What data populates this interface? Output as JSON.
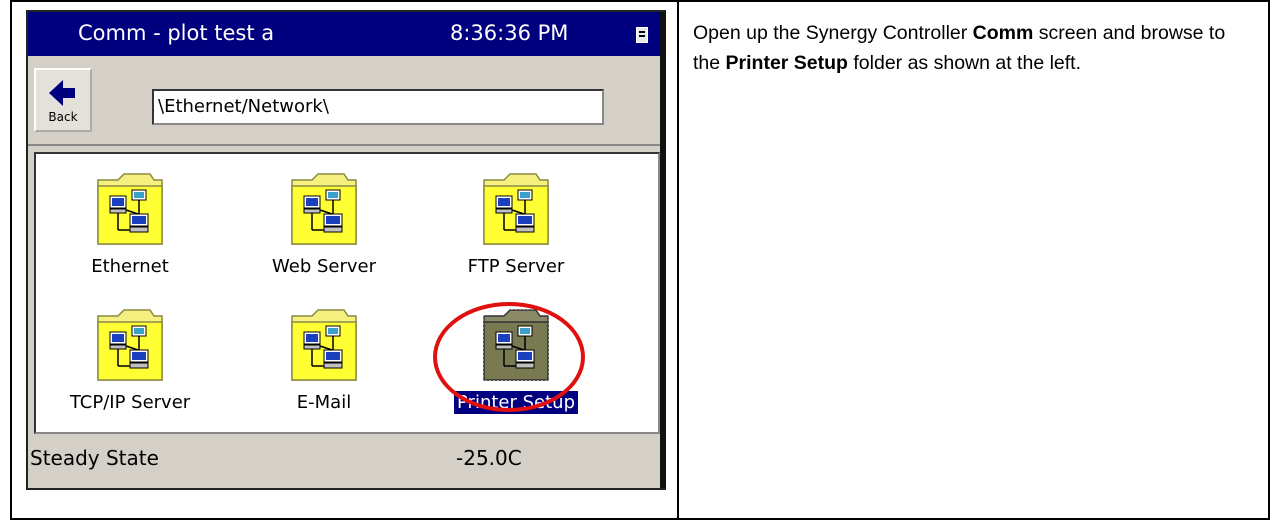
{
  "device": {
    "title": "Comm - plot test a",
    "clock": "8:36:36 PM",
    "back_label": "Back",
    "path": "\\Ethernet/Network\\",
    "folders": [
      {
        "label": "Ethernet",
        "icon": "network-folder-icon"
      },
      {
        "label": "Web Server",
        "icon": "network-folder-icon"
      },
      {
        "label": "FTP Server",
        "icon": "network-folder-icon"
      },
      {
        "label": "TCP/IP Server",
        "icon": "network-folder-icon"
      },
      {
        "label": "E-Mail",
        "icon": "network-folder-icon"
      },
      {
        "label": "Printer Setup",
        "icon": "network-folder-icon",
        "selected": true
      }
    ],
    "status": {
      "state": "Steady State",
      "temperature": "-25.0C"
    },
    "colors": {
      "title_bar": "#00007f",
      "folder": "#ffff33",
      "highlight_ring": "#e01010"
    }
  },
  "instruction": {
    "part1": "Open up the Synergy Controller ",
    "bold1": "Comm",
    "part2": " screen and browse to the ",
    "bold2": "Printer Setup",
    "part3": " folder as shown at the left."
  }
}
